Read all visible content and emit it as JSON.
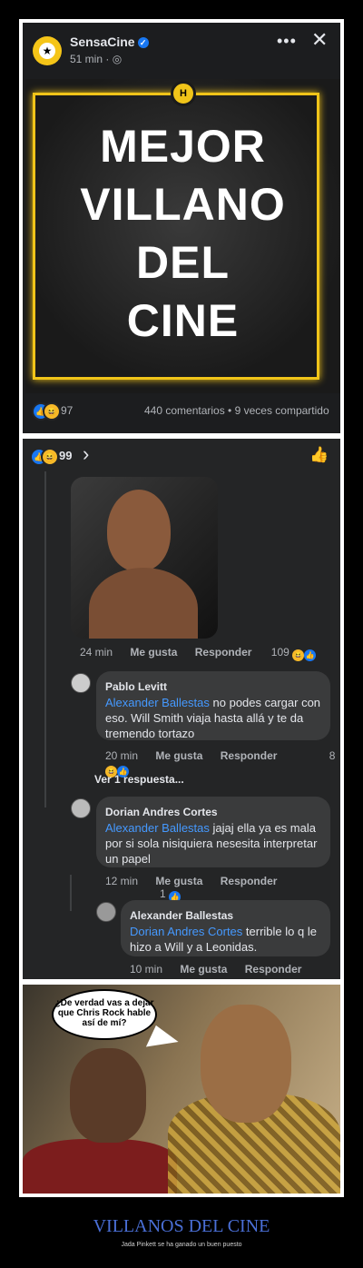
{
  "post": {
    "page_name": "SensaCine",
    "time": "51 min · ",
    "more": "•••",
    "close": "✕",
    "poster_lines": [
      "MEJOR",
      "VILLANO",
      "DEL",
      "CINE"
    ],
    "reactions_count": "97",
    "stats": "440 comentarios • 9 veces compartido"
  },
  "comments_header": {
    "reactions_count": "99",
    "chevron": "›"
  },
  "comments": [
    {
      "time": "24 min",
      "like": "Me gusta",
      "reply": "Responder",
      "count": "109"
    },
    {
      "author": "Pablo Levitt",
      "mention": "Alexander Ballestas",
      "text": " no podes cargar con eso. Will Smith viaja hasta allá y te da tremendo tortazo",
      "time": "20 min",
      "like": "Me gusta",
      "reply": "Responder",
      "count": "8"
    },
    {
      "author": "Dorian Andres Cortes",
      "mention": "Alexander Ballestas",
      "text": " jajaj ella ya es mala por si sola nisiquiera nesesita interpretar un papel",
      "time": "12 min",
      "like": "Me gusta",
      "reply": "Responder",
      "count": "1"
    },
    {
      "author": "Alexander Ballestas",
      "mention": "Dorian Andres Cortes",
      "text": " terrible lo q le hizo a Will y a Leonidas.",
      "time": "10 min",
      "like": "Me gusta",
      "reply": "Responder"
    }
  ],
  "view_replies": "Ver 1 respuesta...",
  "meme": {
    "speech": "¿De verdad vas a dejar que Chris Rock hable así de mí?"
  },
  "caption": {
    "title": "VILLANOS DEL CINE",
    "subtitle": "Jada Pinkett se ha ganado un buen puesto"
  }
}
